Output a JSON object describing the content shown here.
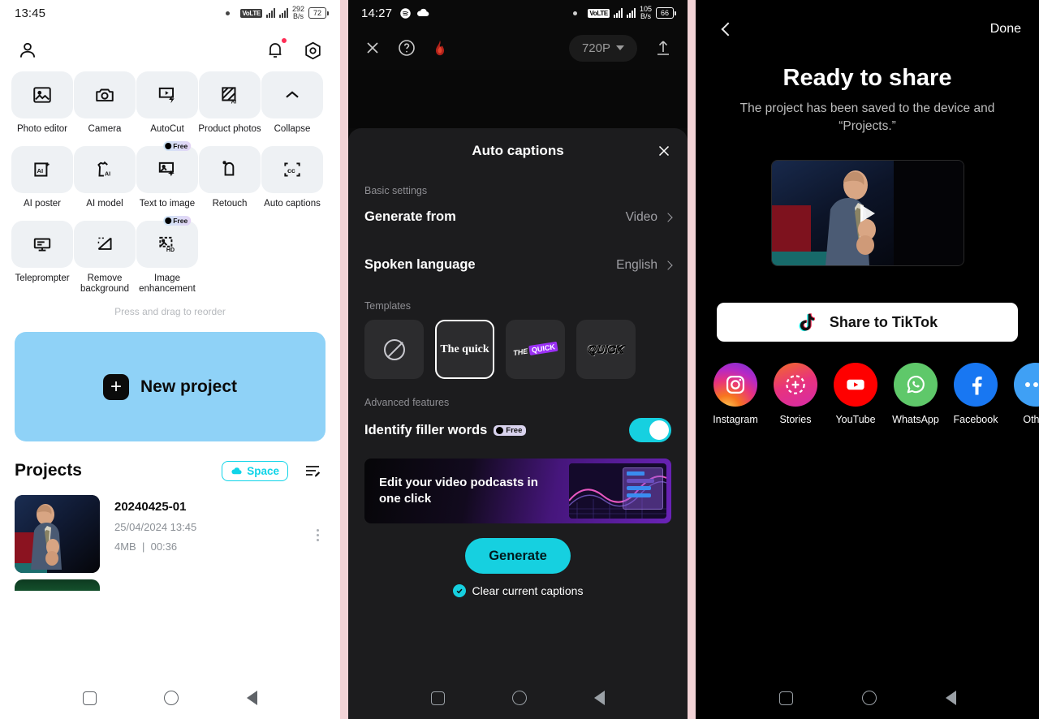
{
  "panel1": {
    "status_bar": {
      "time": "13:45",
      "network_badge": "VoLTE",
      "net_speed_value": "292",
      "net_speed_unit": "B/s",
      "battery": "72"
    },
    "header": {
      "profile_icon": "person-icon",
      "notification_icon": "bell-icon",
      "settings_icon": "gear-icon"
    },
    "tools": [
      {
        "label": "Photo editor",
        "icon": "image-edit-icon",
        "badge": ""
      },
      {
        "label": "Camera",
        "icon": "camera-icon",
        "badge": ""
      },
      {
        "label": "AutoCut",
        "icon": "video-flash-icon",
        "badge": ""
      },
      {
        "label": "Product photos",
        "icon": "ai-photo-icon",
        "badge": ""
      },
      {
        "label": "Collapse",
        "icon": "chevron-up-icon",
        "badge": ""
      },
      {
        "label": "AI poster",
        "icon": "ai-poster-icon",
        "badge": ""
      },
      {
        "label": "AI model",
        "icon": "ai-shirt-icon",
        "badge": ""
      },
      {
        "label": "Text to image",
        "icon": "text-to-image-icon",
        "badge": "Free"
      },
      {
        "label": "Retouch",
        "icon": "retouch-icon",
        "badge": ""
      },
      {
        "label": "Auto captions",
        "icon": "captions-icon",
        "badge": ""
      },
      {
        "label": "Teleprompter",
        "icon": "teleprompter-icon",
        "badge": ""
      },
      {
        "label": "Remove background",
        "icon": "remove-bg-icon",
        "badge": ""
      },
      {
        "label": "Image enhancement",
        "icon": "hd-image-icon",
        "badge": "Free"
      }
    ],
    "reorder_hint": "Press and drag to reorder",
    "new_project": {
      "label": "New project",
      "icon": "plus-icon",
      "bg_color": "#8fd2f7"
    },
    "projects": {
      "title": "Projects",
      "space_button": {
        "label": "Space",
        "icon": "cloud-icon",
        "color": "#10d4e8"
      },
      "sort_icon": "sort-edit-icon",
      "items": [
        {
          "name": "20240425-01",
          "date": "25/04/2024 13:45",
          "size": "4MB",
          "separator": "|",
          "duration": "00:36",
          "menu_icon": "kebab-menu-icon"
        }
      ]
    },
    "nav": {
      "recent": "square-icon",
      "home": "circle-icon",
      "back": "triangle-back-icon"
    }
  },
  "panel2": {
    "status_bar": {
      "time": "14:27",
      "spotify_icon": "spotify-icon",
      "cloud_icon": "cloud-icon",
      "network_badge": "VoLTE",
      "net_speed_value": "105",
      "net_speed_unit": "B/s",
      "battery": "66"
    },
    "toolbar": {
      "close_icon": "close-icon",
      "help_icon": "question-circle-icon",
      "flame_icon": "flame-icon",
      "resolution": "720P",
      "resolution_caret": "caret-down-icon",
      "export_icon": "upload-icon"
    },
    "sheet": {
      "title": "Auto captions",
      "close_icon": "close-icon",
      "basic_settings_label": "Basic settings",
      "settings": [
        {
          "name": "Generate from",
          "value": "Video",
          "chevron": "chevron-right-icon"
        },
        {
          "name": "Spoken language",
          "value": "English",
          "chevron": "chevron-right-icon"
        }
      ],
      "templates_label": "Templates",
      "templates": [
        {
          "id": "none",
          "preview": "",
          "icon": "no-template-icon",
          "selected": false
        },
        {
          "id": "serif",
          "preview": "The quick",
          "icon": "",
          "selected": true
        },
        {
          "id": "highlight",
          "preview_a": "THE",
          "preview_b": "QUICK",
          "icon": "",
          "selected": false
        },
        {
          "id": "outline",
          "preview": "QUICK",
          "icon": "",
          "selected": false
        }
      ],
      "advanced_label": "Advanced features",
      "filler_words": {
        "label": "Identify filler words",
        "badge": "Free",
        "toggle_on": true,
        "toggle_color": "#16d0e0"
      },
      "promo": {
        "text": "Edit your video podcasts in one click"
      },
      "generate_button": {
        "label": "Generate",
        "color": "#16d0e0"
      },
      "clear_captions": {
        "label": "Clear current captions",
        "checked": true
      }
    },
    "nav": {
      "recent": "square-icon",
      "home": "circle-icon",
      "back": "triangle-back-icon"
    }
  },
  "panel3": {
    "header": {
      "back_icon": "chevron-left-icon",
      "done_label": "Done"
    },
    "title": "Ready to share",
    "subtitle": "The project has been saved to the device and “Projects.”",
    "preview": {
      "play_icon": "play-icon"
    },
    "tiktok_button": {
      "label": "Share to TikTok",
      "icon": "tiktok-icon"
    },
    "share_targets": [
      {
        "label": "Instagram",
        "icon": "instagram-icon",
        "color": "#e8337c"
      },
      {
        "label": "Stories",
        "icon": "instagram-stories-icon",
        "color": "#e8337c"
      },
      {
        "label": "YouTube",
        "icon": "youtube-icon",
        "color": "#ff0000"
      },
      {
        "label": "WhatsApp",
        "icon": "whatsapp-icon",
        "color": "#5fc86a"
      },
      {
        "label": "Facebook",
        "icon": "facebook-icon",
        "color": "#1877f2"
      },
      {
        "label": "Other",
        "icon": "more-dots-icon",
        "color": "#3fa0f5"
      }
    ],
    "nav": {
      "recent": "square-icon",
      "home": "circle-icon",
      "back": "triangle-back-icon"
    }
  }
}
